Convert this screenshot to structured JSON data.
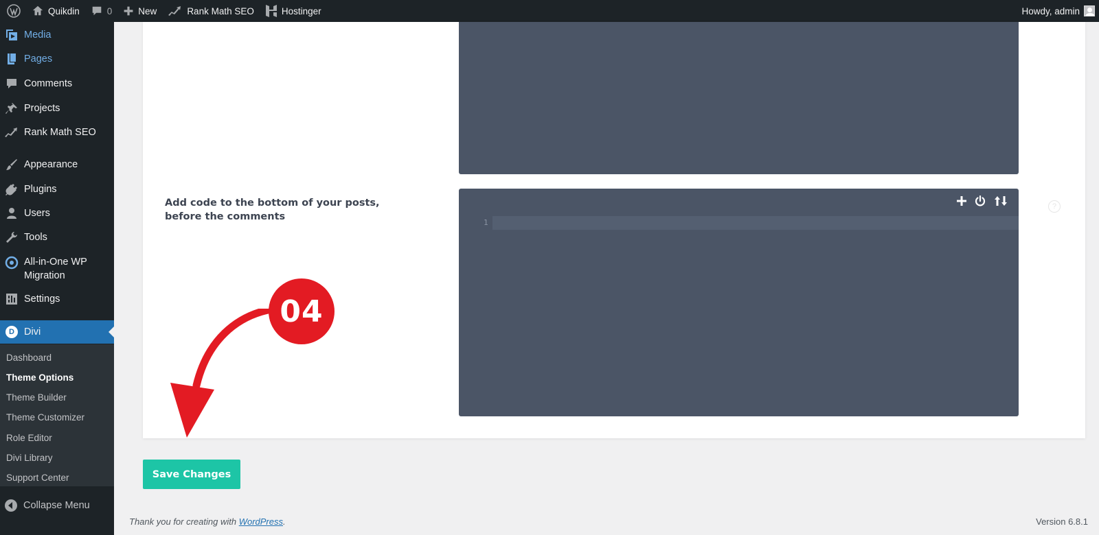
{
  "adminbar": {
    "site_name": "Quikdin",
    "comments_count": "0",
    "new_label": "New",
    "rankmath_label": "Rank Math SEO",
    "hostinger_label": "Hostinger",
    "greeting": "Howdy, admin"
  },
  "sidebar": {
    "items": [
      {
        "label": "Media",
        "icon": "media-icon"
      },
      {
        "label": "Pages",
        "icon": "pages-icon"
      },
      {
        "label": "Comments",
        "icon": "comments-icon"
      },
      {
        "label": "Projects",
        "icon": "pin-icon"
      },
      {
        "label": "Rank Math SEO",
        "icon": "rankmath-icon"
      },
      {
        "label": "Appearance",
        "icon": "brush-icon"
      },
      {
        "label": "Plugins",
        "icon": "plug-icon"
      },
      {
        "label": "Users",
        "icon": "user-icon"
      },
      {
        "label": "Tools",
        "icon": "wrench-icon"
      },
      {
        "label": "All-in-One WP Migration",
        "icon": "migration-icon"
      },
      {
        "label": "Settings",
        "icon": "settings-icon"
      },
      {
        "label": "Divi",
        "icon": "divi-icon",
        "icon_text": "D"
      }
    ],
    "submenu": [
      {
        "label": "Dashboard"
      },
      {
        "label": "Theme Options"
      },
      {
        "label": "Theme Builder"
      },
      {
        "label": "Theme Customizer"
      },
      {
        "label": "Role Editor"
      },
      {
        "label": "Divi Library"
      },
      {
        "label": "Support Center"
      }
    ],
    "collapse_label": "Collapse Menu"
  },
  "main": {
    "field_label": "Add code to the bottom of your posts, before the comments",
    "editor_line_number": "1",
    "help_icon_text": "?",
    "save_label": "Save Changes"
  },
  "annotation": {
    "step_number": "04"
  },
  "footer": {
    "thanks_prefix": "Thank you for creating with ",
    "thanks_link": "WordPress",
    "thanks_suffix": ".",
    "version": "Version 6.8.1"
  },
  "colors": {
    "admin_bar_bg": "#1d2327",
    "accent_blue": "#2271b1",
    "editor_bg": "#4b5566",
    "save_button": "#1dc5a6",
    "annotation_red": "#e31b23"
  }
}
